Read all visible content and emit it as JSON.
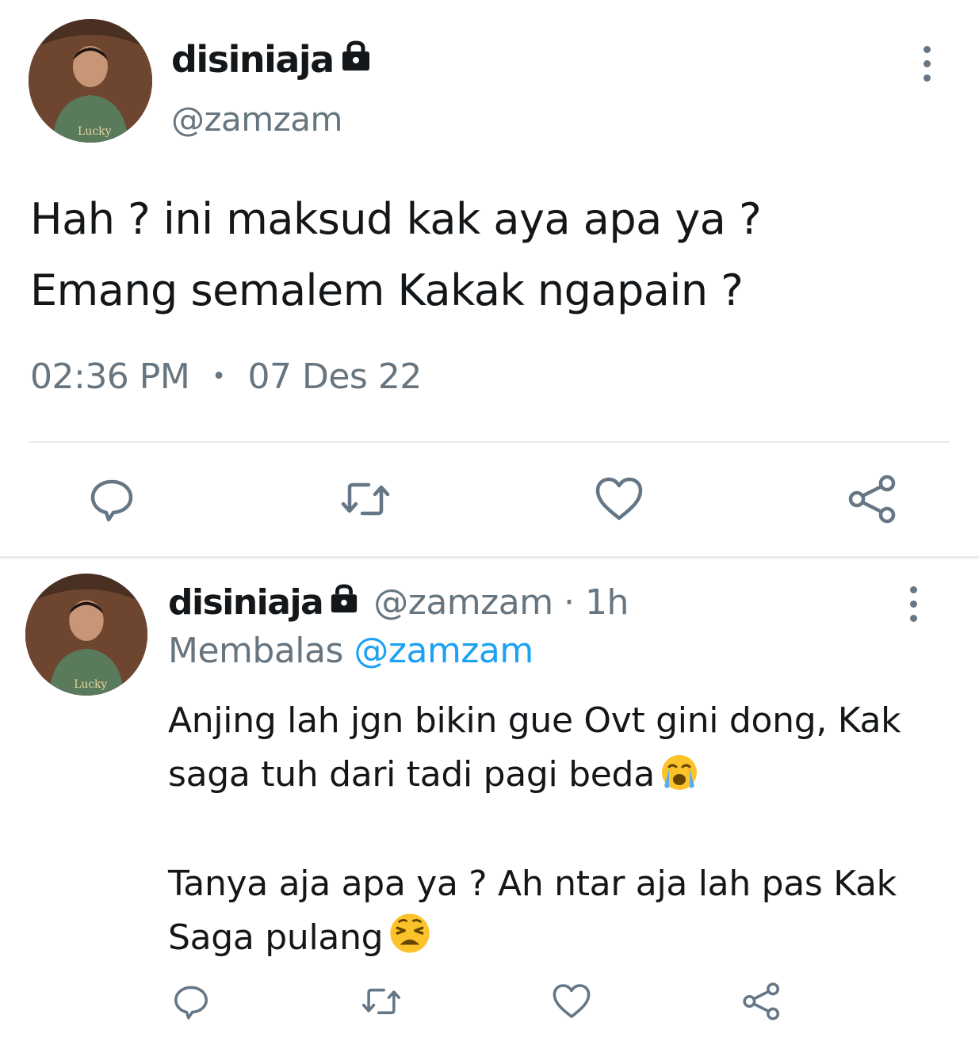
{
  "main_tweet": {
    "display_name": "disiniaja",
    "handle": "@zamzam",
    "text_lines": [
      "Hah ? ini maksud kak aya apa ya ?",
      "Emang semalem Kakak ngapain ?"
    ],
    "time": "02:36 PM",
    "separator": "•",
    "date": "07 Des 22",
    "actions": [
      "reply-icon",
      "retweet-icon",
      "like-icon",
      "share-icon"
    ]
  },
  "reply_tweet": {
    "display_name": "disiniaja",
    "handle_time": "@zamzam · 1h",
    "replying_prefix": "Membalas",
    "replying_to": "@zamzam",
    "paragraphs": [
      {
        "text": "Anjing lah jgn bikin gue Ovt gini dong, Kak saga tuh dari tadi pagi beda",
        "emoji": "loudly-crying-face"
      },
      {
        "text": "Tanya aja apa ya ? Ah ntar aja lah pas Kak Saga pulang",
        "emoji": "weary-face"
      }
    ],
    "actions": [
      "reply-icon",
      "retweet-icon",
      "like-icon",
      "share-icon"
    ]
  },
  "colors": {
    "text": "#14171a",
    "secondary": "#66757f",
    "link": "#1da1f2",
    "divider": "#e6ecf0",
    "icon": "#657786"
  }
}
